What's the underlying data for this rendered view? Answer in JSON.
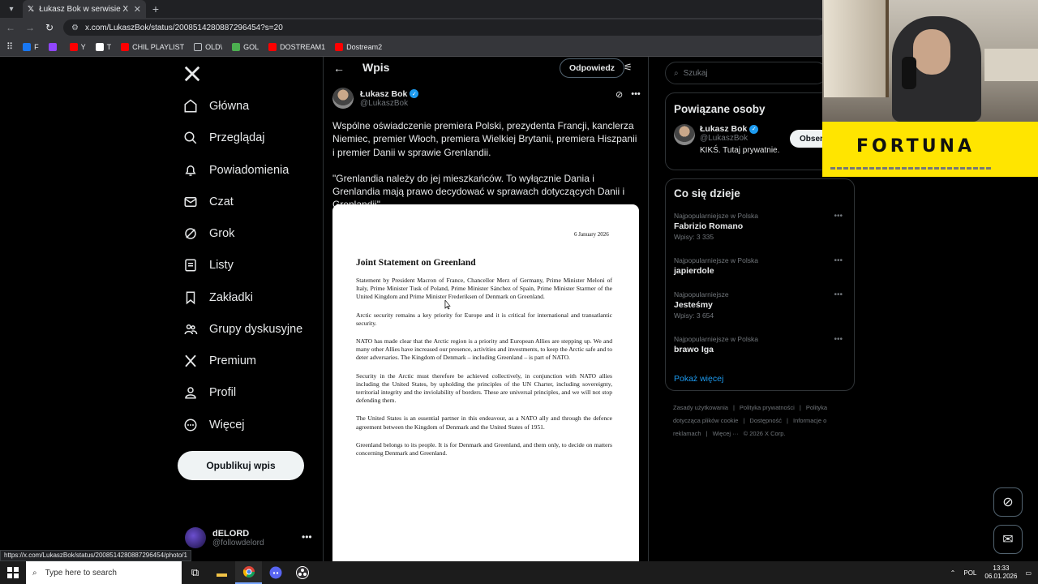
{
  "browser": {
    "tab_title": "Łukasz Bok w serwisie X: „Wsp",
    "url": "x.com/LukaszBok/status/2008514280887296454?s=20",
    "bookmarks": [
      {
        "label": "F",
        "icon": "facebook-icon",
        "color": "#1877f2"
      },
      {
        "label": "",
        "icon": "twitch-icon",
        "color": "#9146ff"
      },
      {
        "label": "Y",
        "icon": "youtube-icon",
        "color": "#ff0000"
      },
      {
        "label": "T",
        "icon": "x-icon",
        "color": "#ffffff"
      },
      {
        "label": "CHIL PLAYLIST",
        "icon": "youtube-icon",
        "color": "#ff0000"
      },
      {
        "label": "OLD\\",
        "icon": "folder-icon",
        "color": "#bdc1c6"
      },
      {
        "label": "GOL",
        "icon": "gol-icon",
        "color": "#4caf50"
      },
      {
        "label": "DOSTREAM1",
        "icon": "youtube-icon",
        "color": "#ff0000"
      },
      {
        "label": "Dostream2",
        "icon": "youtube-icon",
        "color": "#ff0000"
      }
    ],
    "status_url": "https://x.com/LukaszBok/status/2008514280887296454/photo/1"
  },
  "nav": {
    "items": [
      {
        "label": "Główna",
        "icon": "home-icon"
      },
      {
        "label": "Przeglądaj",
        "icon": "search-icon"
      },
      {
        "label": "Powiadomienia",
        "icon": "bell-icon"
      },
      {
        "label": "Czat",
        "icon": "mail-icon"
      },
      {
        "label": "Grok",
        "icon": "grok-icon"
      },
      {
        "label": "Listy",
        "icon": "list-icon"
      },
      {
        "label": "Zakładki",
        "icon": "bookmark-icon"
      },
      {
        "label": "Grupy dyskusyjne",
        "icon": "community-icon"
      },
      {
        "label": "Premium",
        "icon": "x-icon"
      },
      {
        "label": "Profil",
        "icon": "user-icon"
      },
      {
        "label": "Więcej",
        "icon": "more-circle-icon"
      }
    ],
    "post_button": "Opublikuj wpis",
    "account": {
      "name": "dELORD",
      "handle": "@followdelord"
    }
  },
  "main": {
    "title": "Wpis",
    "reply_button": "Odpowiedz",
    "author": {
      "name": "Łukasz Bok",
      "handle": "@LukaszBok"
    },
    "text_1": "Wspólne oświadczenie premiera Polski, prezydenta Francji, kanclerza Niemiec, premier Włoch, premiera Wielkiej Brytanii, premiera Hiszpanii i premier Danii w sprawie Grenlandii.",
    "text_2": "\"Grenlandia należy do jej mieszkańców. To wyłącznie Dania i Grenlandia mają prawo decydować w sprawach dotyczących Danii i Grenlandii\".",
    "document": {
      "date": "6 January 2026",
      "title": "Joint Statement on Greenland",
      "paragraphs": [
        "Statement by President Macron of France, Chancellor Merz of Germany, Prime Minister Meloni of Italy, Prime Minister Tusk of Poland, Prime Minister Sánchez of Spain, Prime Minister Starmer of the United Kingdom and Prime Minister Frederiksen of Denmark on Greenland.",
        "Arctic security remains a key priority for Europe and it is critical for international and transatlantic security.",
        "NATO has made clear that the Arctic region is a priority and European Allies are stepping up. We and many other Allies have increased our presence, activities and investments, to keep the Arctic safe and to deter adversaries. The Kingdom of Denmark – including Greenland – is part of NATO.",
        "Security in the Arctic must therefore be achieved collectively, in conjunction with NATO allies including the United States, by upholding the principles of the UN Charter, including sovereignty, territorial integrity and the inviolability of borders. These are universal principles, and we will not stop defending them.",
        "The United States is an essential partner in this endeavour, as a NATO ally and through the defence agreement between the Kingdom of Denmark and the United States of 1951.",
        "Greenland belongs to its people. It is for Denmark and Greenland, and them only, to decide on matters concerning Denmark and Greenland."
      ]
    }
  },
  "right": {
    "search_placeholder": "Szukaj",
    "related_title": "Powiązane osoby",
    "related": {
      "name": "Łukasz Bok",
      "handle": "@LukaszBok",
      "bio": "KIKŚ. Tutaj prywatnie.",
      "follow": "Obser"
    },
    "trends_title": "Co się dzieje",
    "trends": [
      {
        "context": "Najpopularniejsze w Polska",
        "name": "Fabrizio Romano",
        "count": "Wpisy: 3 335"
      },
      {
        "context": "Najpopularniejsze w Polska",
        "name": "japierdole",
        "count": ""
      },
      {
        "context": "Najpopularniejsze",
        "name": "Jesteśmy",
        "count": "Wpisy: 3 654"
      },
      {
        "context": "Najpopularniejsze w Polska",
        "name": "brawo Iga",
        "count": ""
      }
    ],
    "show_more": "Pokaż więcej",
    "footer": [
      "Zasady użytkowania",
      "|",
      "Polityka prywatności",
      "|",
      "Polityka dotycząca plików cookie",
      "|",
      "Dostępność",
      "|",
      "Informacje o reklamach",
      "|",
      "Więcej ···",
      "© 2026 X Corp."
    ]
  },
  "sponsor": {
    "text": "FORTUNA"
  },
  "taskbar": {
    "search_placeholder": "Type here to search",
    "lang": "POL",
    "time": "13:33",
    "date": "06.01.2026"
  }
}
